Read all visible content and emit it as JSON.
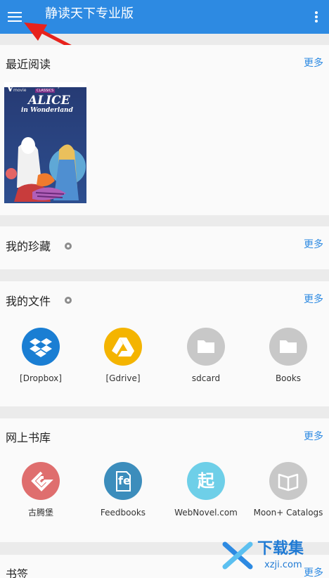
{
  "app_bar": {
    "title": "静读天下专业版",
    "menu_icon": "hamburger-menu-icon",
    "overflow_icon": "more-vert-icon",
    "color": "#2d8ae2"
  },
  "recent": {
    "title": "最近阅读",
    "more": "更多",
    "book": {
      "brand": "Walt Disney",
      "series": "CLASSICS",
      "title": "ALICE",
      "subtitle": "in Wonderland",
      "corner": "V",
      "corner_small": "movie"
    }
  },
  "favorites": {
    "title": "我的珍藏",
    "more": "更多",
    "icon": "gear-icon"
  },
  "files": {
    "title": "我的文件",
    "more": "更多",
    "icon": "gear-icon",
    "items": [
      {
        "label": "[Dropbox]",
        "icon": "dropbox-icon",
        "color": "#1a7ed3"
      },
      {
        "label": "[Gdrive]",
        "icon": "google-drive-icon",
        "color": "#f4b400"
      },
      {
        "label": "sdcard",
        "icon": "folder-icon",
        "color": "#c8c8c8"
      },
      {
        "label": "Books",
        "icon": "folder-icon",
        "color": "#c8c8c8"
      }
    ]
  },
  "online": {
    "title": "网上书库",
    "more": "更多",
    "items": [
      {
        "label": "古腾堡",
        "icon": "gutenberg-icon",
        "color": "#df6e6e"
      },
      {
        "label": "Feedbooks",
        "icon": "feedbooks-icon",
        "color": "#3c8dbc",
        "glyph": "fe"
      },
      {
        "label": "WebNovel.com",
        "icon": "webnovel-icon",
        "color": "#6ecfe8",
        "glyph": "起"
      },
      {
        "label": "Moon+ Catalogs",
        "icon": "open-book-icon",
        "color": "#c8c8c8"
      }
    ]
  },
  "bookmarks": {
    "title": "书签",
    "more": "更多"
  },
  "watermark": {
    "text": "下载集",
    "site": "xzji.com"
  }
}
